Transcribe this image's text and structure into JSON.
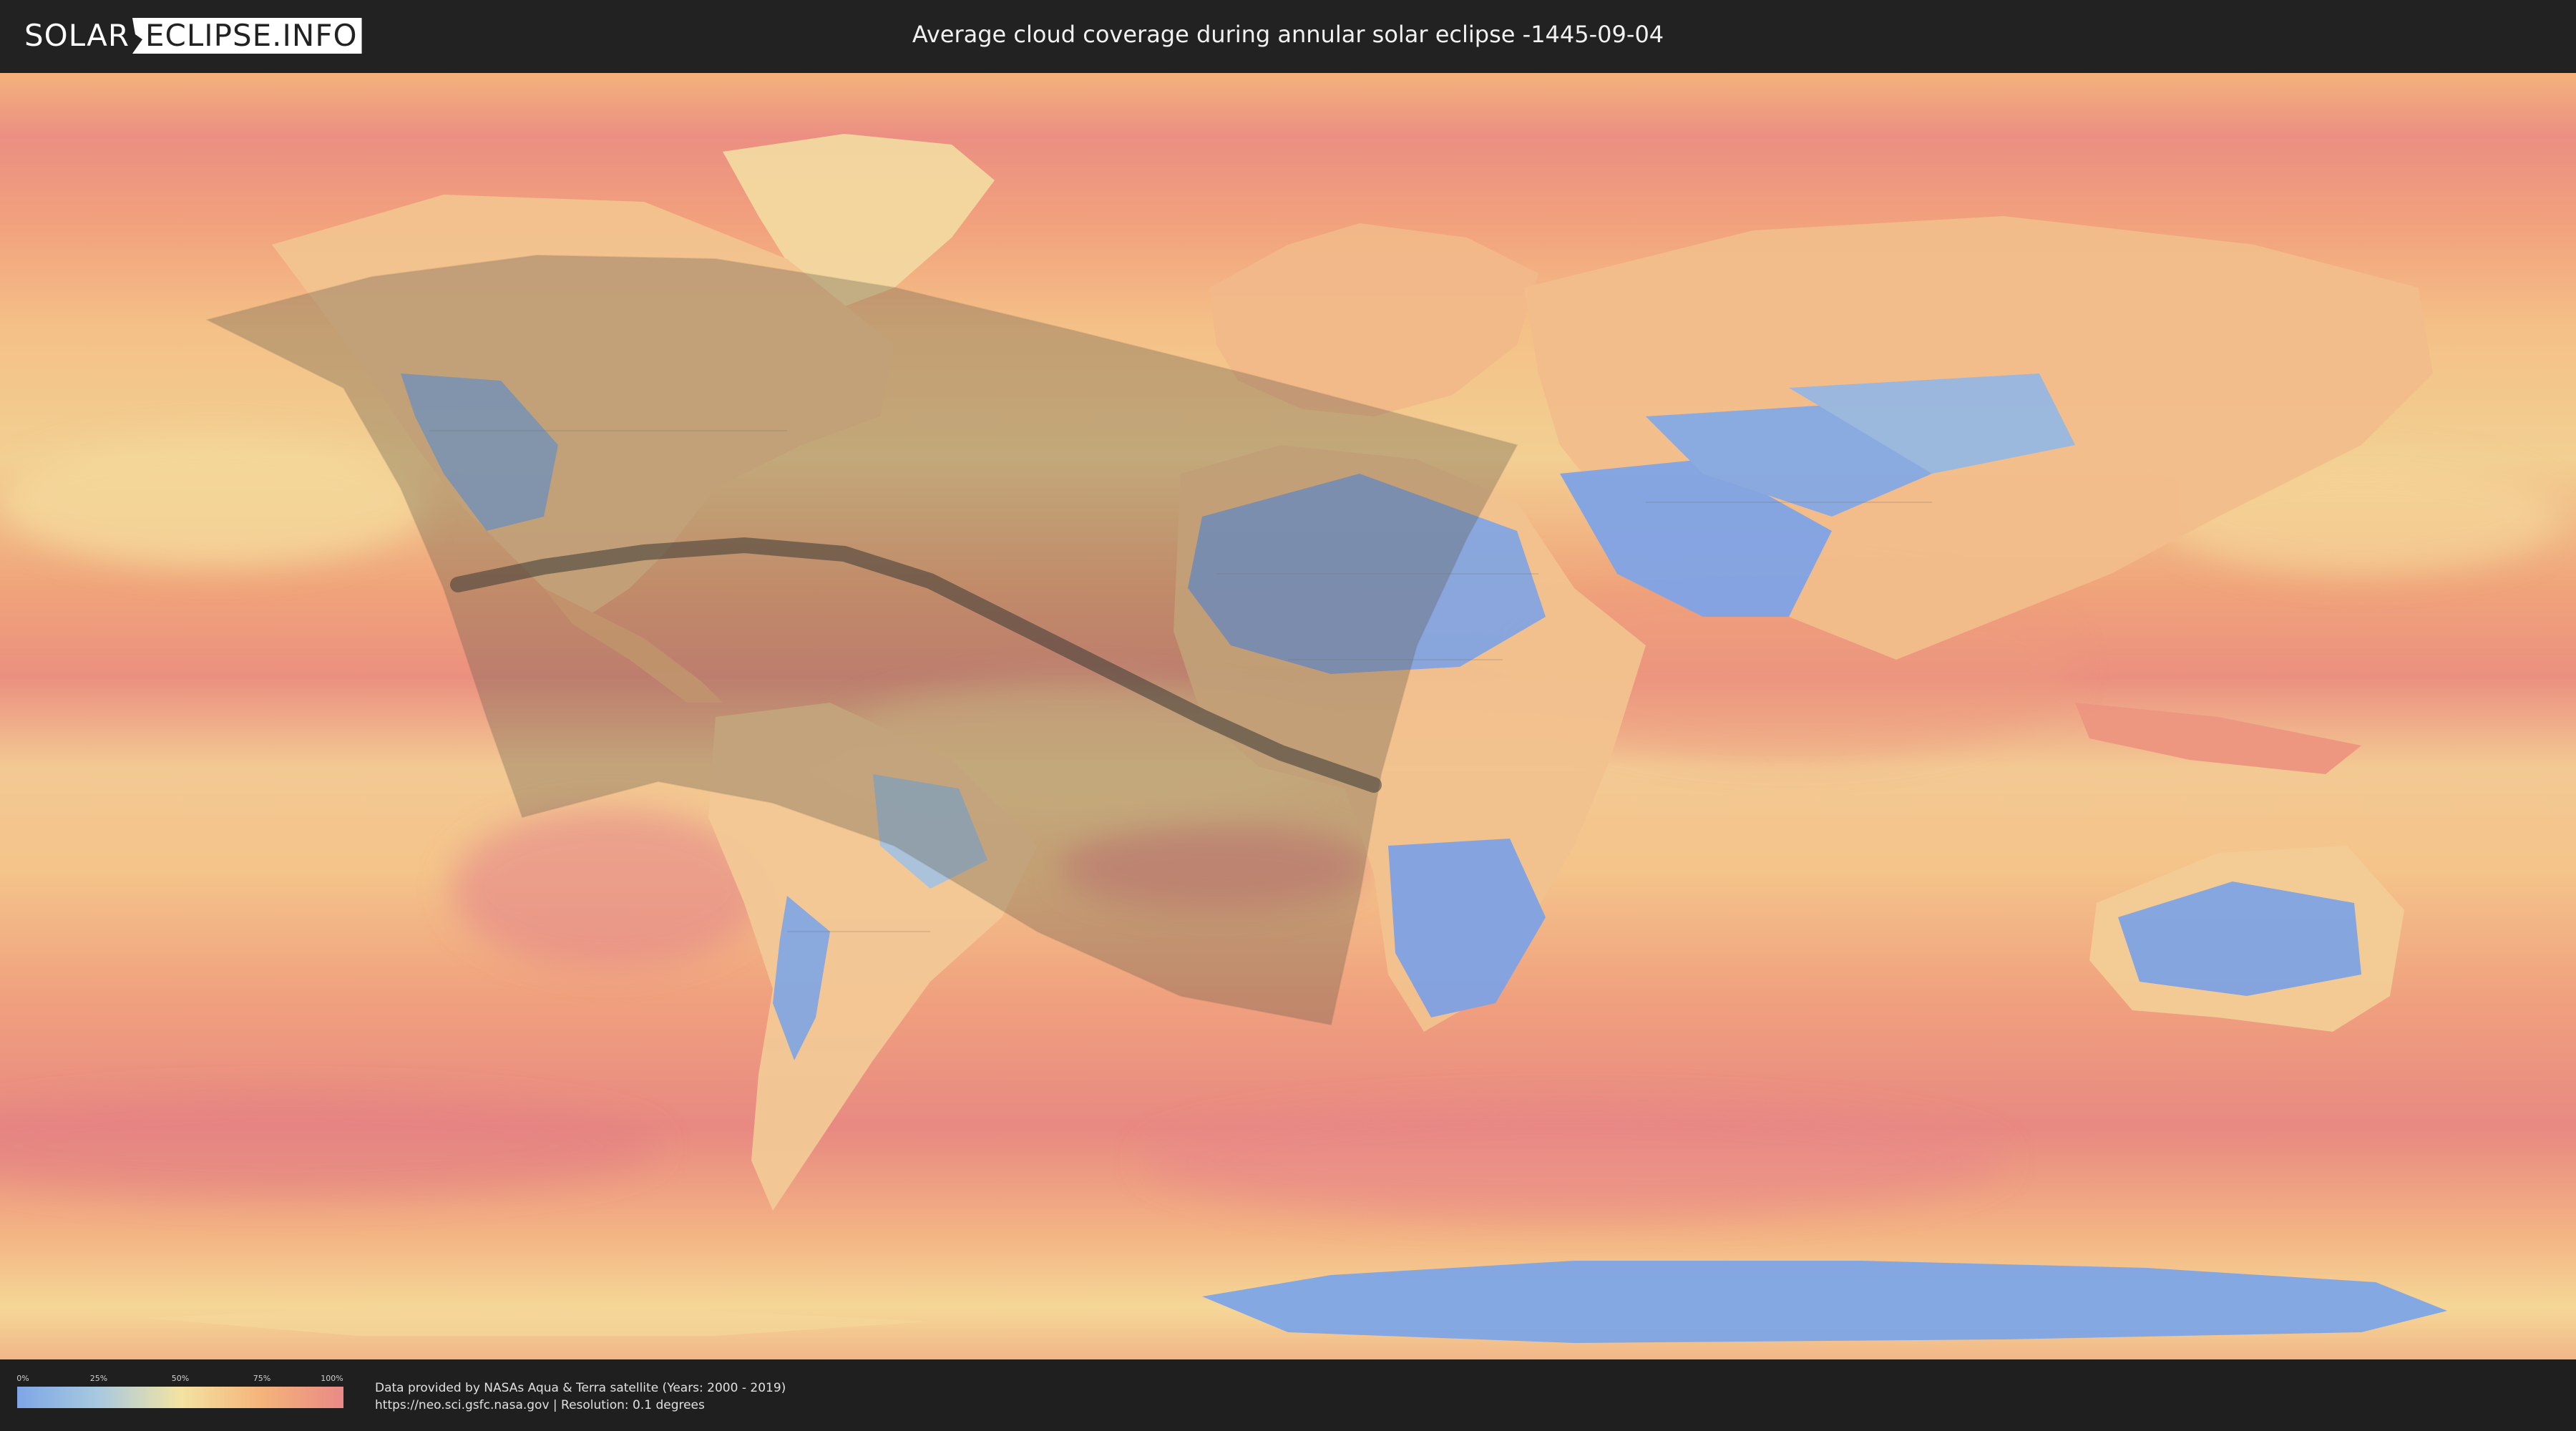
{
  "header": {
    "logo": {
      "left": "SOLAR",
      "right": "ECLIPSE.INFO"
    },
    "title": "Average cloud coverage during annular solar eclipse -1445-09-04"
  },
  "map": {
    "description_colors": {
      "clear": "#7ea6e6",
      "low": "#a8c9e0",
      "mid": "#f3e3a2",
      "high": "#f5b37a",
      "overcast": "#e98a86",
      "eclipse_overlay": "#5a5548",
      "central_path": "#3a3a36"
    }
  },
  "legend": {
    "ticks": [
      "0%",
      "25%",
      "50%",
      "75%",
      "100%"
    ]
  },
  "footer": {
    "credit_line1": "Data provided by NASAs Aqua & Terra satellite (Years: 2000 - 2019)",
    "credit_line2": "https://neo.sci.gsfc.nasa.gov | Resolution: 0.1 degrees"
  }
}
